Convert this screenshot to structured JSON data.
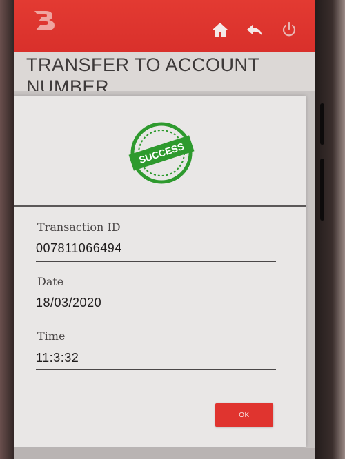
{
  "app": {
    "title": "TRANSFER TO ACCOUNT NUMBER",
    "logo_icon": "bank-logo-icon",
    "header_icons": [
      "home-icon",
      "back-icon",
      "power-icon"
    ],
    "brand_color": "#e33a32"
  },
  "dialog": {
    "status_stamp": "SUCCESS",
    "status_color": "#2e9a2e",
    "fields": [
      {
        "label": "Transaction ID",
        "value": "007811066494"
      },
      {
        "label": "Date",
        "value": "18/03/2020"
      },
      {
        "label": "Time",
        "value": "11:3:32"
      }
    ],
    "ok_label": "OK"
  }
}
